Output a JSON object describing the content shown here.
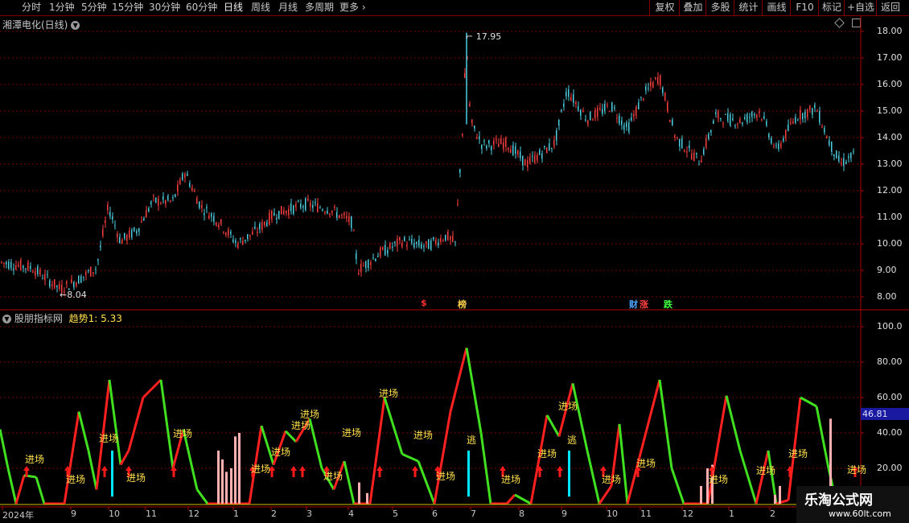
{
  "toolbar": {
    "periods": [
      "分时",
      "1分钟",
      "5分钟",
      "15分钟",
      "30分钟",
      "60分钟",
      "日线",
      "周线",
      "月线",
      "多周期",
      "更多"
    ],
    "active_period": "日线",
    "more_arrow": "›",
    "right_buttons": [
      "复权",
      "叠加",
      "多股",
      "统计",
      "画线",
      "F10",
      "标记",
      "+自选",
      "返回"
    ]
  },
  "main_panel": {
    "title": "湘潭电化(日线)",
    "high_label": "17.95",
    "low_label": "8.04",
    "y_ticks": [
      "18.00",
      "17.00",
      "16.00",
      "15.00",
      "14.00",
      "13.00",
      "12.00",
      "11.00",
      "10.00",
      "9.00",
      "8.00"
    ],
    "event_markers": [
      {
        "text": "$",
        "color": "#ff3030"
      },
      {
        "text": "榜",
        "color": "#ffd24d"
      },
      {
        "text": "财",
        "color": "#4da6ff"
      },
      {
        "text": "涨",
        "color": "#ff4040"
      },
      {
        "text": "跌",
        "color": "#40ff40"
      }
    ]
  },
  "indicator_panel": {
    "title": "股朋指标网",
    "series_label": "趋势1: 5.33",
    "y_ticks": [
      "100.0",
      "80.00",
      "60.00",
      "40.00",
      "20.00"
    ],
    "current_value": "46.81",
    "entry_label": "进场",
    "escape_label": "逃",
    "entry_points": [
      {
        "x": 44,
        "y": 575
      },
      {
        "x": 95,
        "y": 600
      },
      {
        "x": 136,
        "y": 549
      },
      {
        "x": 170,
        "y": 598
      },
      {
        "x": 228,
        "y": 543
      },
      {
        "x": 325,
        "y": 587
      },
      {
        "x": 350,
        "y": 566
      },
      {
        "x": 375,
        "y": 533
      },
      {
        "x": 386,
        "y": 519
      },
      {
        "x": 415,
        "y": 596
      },
      {
        "x": 438,
        "y": 542
      },
      {
        "x": 484,
        "y": 493
      },
      {
        "x": 527,
        "y": 545
      },
      {
        "x": 555,
        "y": 596
      },
      {
        "x": 636,
        "y": 600
      },
      {
        "x": 681,
        "y": 568
      },
      {
        "x": 707,
        "y": 509
      },
      {
        "x": 761,
        "y": 600
      },
      {
        "x": 804,
        "y": 580
      },
      {
        "x": 894,
        "y": 600
      },
      {
        "x": 953,
        "y": 589
      },
      {
        "x": 993,
        "y": 568
      },
      {
        "x": 1066,
        "y": 588
      }
    ],
    "escape_points": [
      {
        "x": 586,
        "y": 551
      },
      {
        "x": 711,
        "y": 551
      }
    ]
  },
  "date_axis": [
    {
      "text": "2024年",
      "x": 3
    },
    {
      "text": "9",
      "x": 88
    },
    {
      "text": "10",
      "x": 135
    },
    {
      "text": "11",
      "x": 181
    },
    {
      "text": "12",
      "x": 234
    },
    {
      "text": "1",
      "x": 290
    },
    {
      "text": "2",
      "x": 337
    },
    {
      "text": "3",
      "x": 381
    },
    {
      "text": "4",
      "x": 433
    },
    {
      "text": "5",
      "x": 488
    },
    {
      "text": "6",
      "x": 537
    },
    {
      "text": "7",
      "x": 585
    },
    {
      "text": "8",
      "x": 645
    },
    {
      "text": "9",
      "x": 698
    },
    {
      "text": "10",
      "x": 754
    },
    {
      "text": "11",
      "x": 796
    },
    {
      "text": "12",
      "x": 848
    },
    {
      "text": "1",
      "x": 906
    },
    {
      "text": "2",
      "x": 957
    }
  ],
  "watermark": {
    "title": "乐淘公式网",
    "url": "www.60lt.com"
  },
  "colors": {
    "up": "#ff4040",
    "down": "#4dd0e1",
    "grid": "#8b0000",
    "accent_box": "#1a1aa0",
    "entry_text": "#ffe04d",
    "bars": "#ffb0b0"
  }
}
